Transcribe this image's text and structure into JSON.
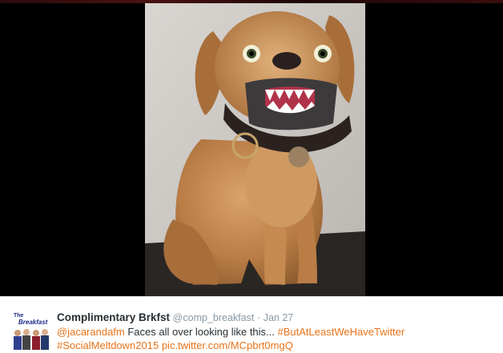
{
  "media": {
    "alt_icon": "photo-of-dog-with-fake-teeth"
  },
  "avatar": {
    "title_line1": "The",
    "title_line2": "Breakfast"
  },
  "tweet": {
    "fullname": "Complimentary Brkfst",
    "username": "@comp_breakfast",
    "separator": "·",
    "time": "Jan 27",
    "mention": "@jacarandafm",
    "text_body": " Faces all over looking like this... ",
    "hashtag1": "#ButAtLeastWeHaveTwitter",
    "hashtag2": "#SocialMeltdown2015",
    "link": "pic.twitter.com/MCpbrt0mgQ"
  },
  "colors": {
    "link": "#e8731a",
    "text": "#292f33",
    "muted": "#8899a6",
    "media_bg": "#000000"
  }
}
